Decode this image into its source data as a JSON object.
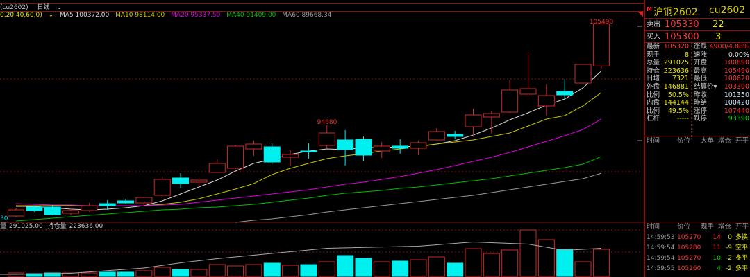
{
  "header": {
    "symbol_code": "(cu2602)",
    "period": "日线",
    "period_dropdown_icon": "chevron-down-icon"
  },
  "ma_bar": {
    "params": "0,20,40,60,0)",
    "ma5": "MA5 100372.00",
    "ma10": "MA10 98114.00",
    "ma20": "MA20 95337.50",
    "ma40": "MA40 91409.00",
    "ma60": "MA60 89668.34",
    "colors": {
      "ma5": "#d8d8d8",
      "ma10": "#c8c800",
      "ma20": "#e000e0",
      "ma40": "#00c000",
      "ma60": "#9a9a9a"
    }
  },
  "price_axis_partial_label": "30",
  "volume_header": {
    "vol_label": "量",
    "vol_value": "291025.00",
    "oi_label": "持仓量",
    "oi_value": "223636.00"
  },
  "colors": {
    "up": "#d02828",
    "down": "#00f0f0",
    "border": "#8b1010"
  },
  "chart_data": {
    "type": "candlestick",
    "ylim": [
      84596,
      105780
    ],
    "high_label": "105490",
    "mid_label": "94680",
    "candles": [
      {
        "o": 85176,
        "c": 85829,
        "h": 85974,
        "l": 85104,
        "v": 37310
      },
      {
        "o": 86120,
        "c": 85757,
        "h": 86265,
        "l": 85612,
        "v": 29848
      },
      {
        "o": 86120,
        "c": 85322,
        "h": 86337,
        "l": 85249,
        "v": 37310
      },
      {
        "o": 85467,
        "c": 85757,
        "h": 86047,
        "l": 85249,
        "v": 37310
      },
      {
        "o": 85757,
        "c": 86265,
        "h": 86555,
        "l": 85612,
        "v": 37310
      },
      {
        "o": 86482,
        "c": 86265,
        "h": 86844,
        "l": 85829,
        "v": 44772
      },
      {
        "o": 86772,
        "c": 86555,
        "h": 86990,
        "l": 86482,
        "v": 44772
      },
      {
        "o": 86555,
        "c": 87132,
        "h": 87208,
        "l": 86337,
        "v": 59696
      },
      {
        "o": 87353,
        "c": 89021,
        "h": 89312,
        "l": 87281,
        "v": 97006
      },
      {
        "o": 89167,
        "c": 88586,
        "h": 89674,
        "l": 88078,
        "v": 74620
      },
      {
        "o": 88731,
        "c": 88948,
        "h": 89167,
        "l": 88223,
        "v": 74620
      },
      {
        "o": 89747,
        "c": 90690,
        "h": 91126,
        "l": 89747,
        "v": 126854
      },
      {
        "o": 90183,
        "c": 92504,
        "h": 92649,
        "l": 90110,
        "v": 111930
      },
      {
        "o": 92214,
        "c": 92722,
        "h": 93085,
        "l": 91488,
        "v": 126854
      },
      {
        "o": 92431,
        "c": 90836,
        "h": 92794,
        "l": 90618,
        "v": 141778
      },
      {
        "o": 91343,
        "c": 91633,
        "h": 92141,
        "l": 90400,
        "v": 119392
      },
      {
        "o": 91996,
        "c": 91923,
        "h": 92794,
        "l": 91198,
        "v": 126854
      },
      {
        "o": 92577,
        "c": 93882,
        "h": 94680,
        "l": 92286,
        "v": 156702
      },
      {
        "o": 93157,
        "c": 92141,
        "h": 94173,
        "l": 90473,
        "v": 223860
      },
      {
        "o": 93229,
        "c": 91561,
        "h": 93519,
        "l": 90980,
        "v": 194012
      },
      {
        "o": 91996,
        "c": 92504,
        "h": 92939,
        "l": 91271,
        "v": 156702
      },
      {
        "o": 92504,
        "c": 92286,
        "h": 93229,
        "l": 91706,
        "v": 164164
      },
      {
        "o": 92286,
        "c": 92867,
        "h": 93085,
        "l": 91561,
        "v": 179088
      },
      {
        "o": 93157,
        "c": 94028,
        "h": 94391,
        "l": 93085,
        "v": 208936
      },
      {
        "o": 93737,
        "c": 93519,
        "h": 94101,
        "l": 93229,
        "v": 141778
      },
      {
        "o": 94535,
        "c": 95769,
        "h": 96422,
        "l": 93519,
        "v": 298480
      },
      {
        "o": 95551,
        "c": 95914,
        "h": 96204,
        "l": 93810,
        "v": 246246
      },
      {
        "o": 96059,
        "c": 98381,
        "h": 99396,
        "l": 95987,
        "v": 283556
      },
      {
        "o": 97945,
        "c": 98526,
        "h": 102371,
        "l": 97655,
        "v": 499954
      },
      {
        "o": 96712,
        "c": 97800,
        "h": 98961,
        "l": 95696,
        "v": 395486
      },
      {
        "o": 98236,
        "c": 97873,
        "h": 99541,
        "l": 97437,
        "v": 290000
      },
      {
        "o": 99106,
        "c": 101065,
        "h": 101065,
        "l": 98961,
        "v": 156702
      },
      {
        "o": 100890,
        "c": 105320,
        "h": 105490,
        "l": 100670,
        "v": 291025
      }
    ],
    "ma": {
      "ma5": [
        86192,
        86192,
        86047,
        85902,
        85829,
        85902,
        86047,
        86265,
        86772,
        87498,
        88224,
        88949,
        89893,
        90694,
        91127,
        91635,
        91995,
        92214,
        92141,
        92359,
        92359,
        92431,
        92504,
        92722,
        93085,
        93665,
        94395,
        95261,
        95987,
        96784,
        97437,
        98598,
        100372
      ],
      "ma10": [
        86265,
        86265,
        86265,
        86265,
        86265,
        86265,
        86265,
        86265,
        86410,
        86626,
        86990,
        87498,
        88004,
        88586,
        89529,
        90183,
        90694,
        91198,
        91488,
        91706,
        91995,
        92214,
        92431,
        92722,
        92939,
        93157,
        93519,
        93882,
        94608,
        95333,
        95696,
        96712,
        98114
      ],
      "ma20": [
        86482,
        86410,
        86337,
        86337,
        86265,
        86265,
        86265,
        86265,
        86337,
        86410,
        86626,
        86844,
        87062,
        87281,
        87498,
        87716,
        87933,
        88224,
        88513,
        88731,
        89021,
        89312,
        89675,
        90037,
        90473,
        90908,
        91343,
        91851,
        92431,
        93011,
        93592,
        94245,
        95337
      ],
      "ma40": [
        84669,
        84814,
        84959,
        85104,
        85249,
        85394,
        85539,
        85684,
        85829,
        85902,
        86047,
        86120,
        86265,
        86410,
        86626,
        86844,
        87062,
        87353,
        87570,
        87716,
        87861,
        88078,
        88224,
        88441,
        88659,
        88877,
        89094,
        89384,
        89675,
        89965,
        90255,
        90618,
        91409
      ],
      "ma60": [
        null,
        null,
        null,
        null,
        null,
        null,
        null,
        null,
        null,
        null,
        null,
        null,
        84523,
        84741,
        84886,
        85104,
        85322,
        85612,
        85829,
        86047,
        86265,
        86482,
        86700,
        86917,
        87135,
        87353,
        87643,
        87933,
        88224,
        88513,
        88803,
        89094,
        89668
      ]
    },
    "volume_ylim": [
      0,
      514878
    ],
    "open_interest": {
      "ylim": [
        183136,
        264136
      ],
      "points": [
        [
          0,
          186136
        ],
        [
          3,
          187636
        ],
        [
          7,
          195136
        ],
        [
          9,
          202636
        ],
        [
          11,
          208636
        ],
        [
          17,
          223636
        ],
        [
          22,
          226636
        ],
        [
          25,
          232636
        ],
        [
          28,
          229636
        ],
        [
          30,
          220636
        ],
        [
          32,
          223636
        ]
      ]
    }
  },
  "quote_panel": {
    "market_badge": "M",
    "name": "沪铜2602",
    "code": "cu2602",
    "ask": {
      "label": "卖出",
      "price": "105330",
      "volume": "22"
    },
    "bid": {
      "label": "买入",
      "price": "105300",
      "volume": "3"
    },
    "stats": [
      {
        "l1": "最新",
        "v1": "105320",
        "c1": "red",
        "l2": "涨跌",
        "v2": "4900/4.88%",
        "c2": "red"
      },
      {
        "l1": "现手",
        "v1": "8",
        "c1": "yel",
        "l2": "速涨",
        "v2": "0.00%",
        "c2": "wht"
      },
      {
        "l1": "总量",
        "v1": "291025",
        "c1": "yel",
        "l2": "开盘",
        "v2": "100890",
        "c2": "red"
      },
      {
        "l1": "持仓",
        "v1": "223636",
        "c1": "yel",
        "l2": "最高",
        "v2": "105490",
        "c2": "red"
      },
      {
        "l1": "日增",
        "v1": "7321",
        "c1": "yel",
        "l2": "最低",
        "v2": "100670",
        "c2": "red"
      },
      {
        "l1": "外盘",
        "v1": "146881",
        "c1": "yel",
        "l2": "结算价▾",
        "v2": "103300",
        "c2": "red"
      },
      {
        "l1": "比例",
        "v1": "50.5%",
        "c1": "yel",
        "l2": "昨收",
        "v2": "101350",
        "c2": "blu"
      },
      {
        "l1": "内盘",
        "v1": "144144",
        "c1": "yel",
        "l2": "昨结",
        "v2": "100420",
        "c2": "blu"
      },
      {
        "l1": "比例",
        "v1": "49.5%",
        "c1": "yel",
        "l2": "涨停",
        "v2": "107440",
        "c2": "red"
      },
      {
        "l1": "杠杆",
        "v1": "-----",
        "c1": "yel",
        "l2": "跌停",
        "v2": "93390",
        "c2": "grn"
      }
    ],
    "bigorder_header": [
      "时间",
      "价位",
      "大单",
      "增仓",
      "开平"
    ],
    "tick_header": [
      "时间",
      "价位",
      "现手",
      "增仓",
      "开平"
    ],
    "ticks": [
      {
        "time": "14:59:53",
        "price": "105270",
        "qty": "14",
        "qty_c": "red",
        "oi": "0",
        "type": "多换"
      },
      {
        "time": "14:59:54",
        "price": "105280",
        "qty": "11",
        "qty_c": "red",
        "oi": "-9",
        "type": "空平"
      },
      {
        "time": "14:59:54",
        "price": "105270",
        "qty": "10",
        "qty_c": "grn",
        "oi": "-2",
        "type": "多平"
      },
      {
        "time": "14:59:55",
        "price": "105260",
        "qty": "4",
        "qty_c": "grn",
        "oi": "-2",
        "type": "多平"
      }
    ]
  }
}
